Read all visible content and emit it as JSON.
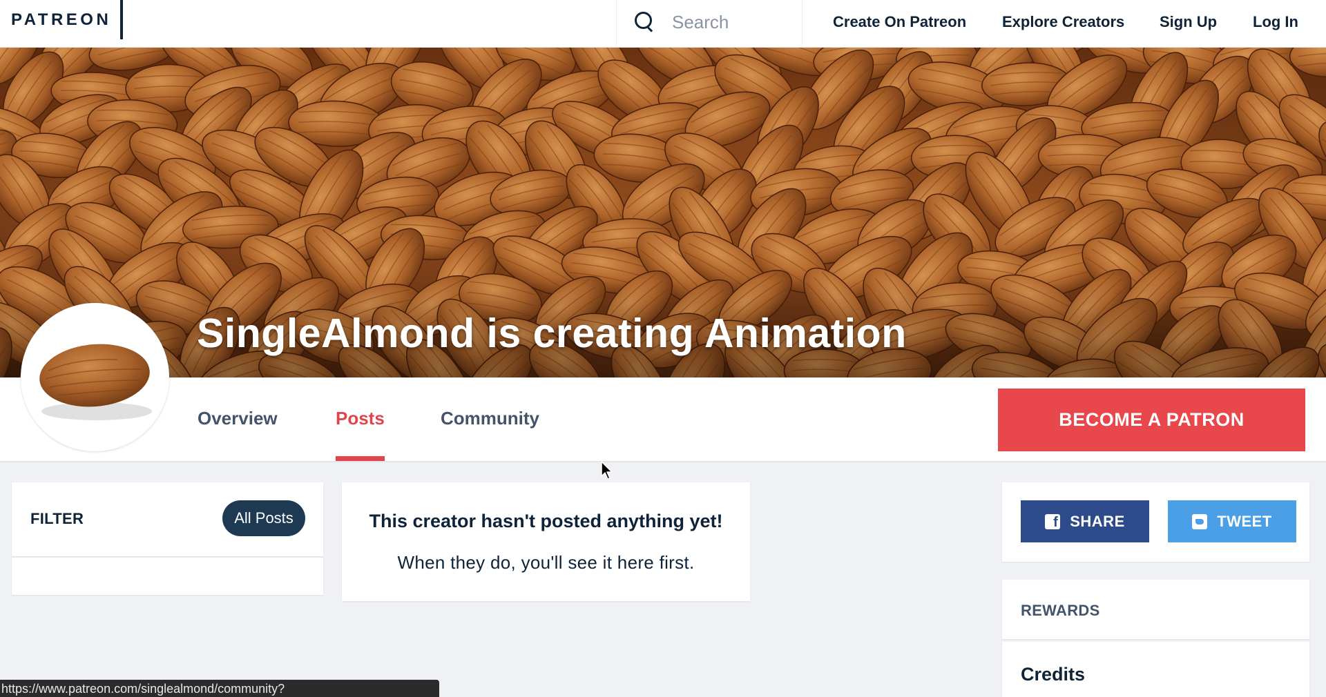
{
  "nav": {
    "logo": "PATREON",
    "search_placeholder": "Search",
    "links": [
      "Create On Patreon",
      "Explore Creators",
      "Sign Up",
      "Log In"
    ]
  },
  "cover": {
    "creator_name": "SingleAlmond",
    "tagline": " is creating Animation"
  },
  "tabs": [
    {
      "label": "Overview",
      "active": false
    },
    {
      "label": "Posts",
      "active": true
    },
    {
      "label": "Community",
      "active": false
    }
  ],
  "cta": {
    "label": "BECOME A PATRON",
    "color": "#e8484c"
  },
  "filter": {
    "label": "FILTER",
    "button": "All Posts"
  },
  "empty": {
    "title": "This creator hasn't posted anything yet!",
    "subtitle": "When they do, you'll see it here first."
  },
  "social": {
    "share": "SHARE",
    "tweet": "TWEET"
  },
  "rewards": {
    "label": "REWARDS",
    "first_tier_title": "Credits"
  },
  "status_url": "https://www.patreon.com/singlealmond/community?",
  "colors": {
    "brand_navy": "#0f2338",
    "accent_red": "#e0454b",
    "facebook": "#2d4a8a",
    "twitter": "#4a9fe6"
  }
}
